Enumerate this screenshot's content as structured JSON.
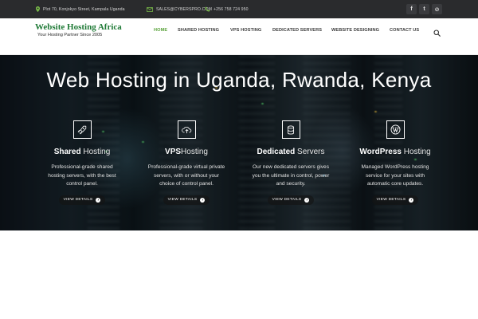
{
  "topbar": {
    "address": "Plot 70, Konjokyo Street, Kampala Uganda",
    "email": "SALES@CYBERSPRO.COM",
    "phone": "+256 758 724 950",
    "social": [
      {
        "icon": "facebook-icon",
        "glyph": "f"
      },
      {
        "icon": "twitter-icon",
        "glyph": "t"
      },
      {
        "icon": "rss-icon",
        "glyph": "⊘"
      }
    ]
  },
  "header": {
    "logo_title": "Website Hosting Africa",
    "logo_tagline": "Your Hosting Partner Since 2005",
    "nav": [
      {
        "label": "HOME",
        "active": true
      },
      {
        "label": "SHARED HOSTING",
        "active": false
      },
      {
        "label": "VPS HOSTING",
        "active": false
      },
      {
        "label": "DEDICATED SERVERS",
        "active": false
      },
      {
        "label": "WEBSITE DESIGNING",
        "active": false
      },
      {
        "label": "CONTACT US",
        "active": false
      }
    ],
    "search_icon": "search-icon"
  },
  "hero": {
    "title": "Web Hosting in Uganda, Rwanda, Kenya",
    "services": [
      {
        "icon": "rocket-icon",
        "title_bold": "Shared",
        "title_light": " Hosting",
        "description": "Professional-grade shared hosting servers, with the best control panel.",
        "button": "VIEW DETAILS"
      },
      {
        "icon": "cloud-upload-icon",
        "title_bold": "VPS",
        "title_light": "Hosting",
        "description": "Professional-grade virtual private servers, with or without your choice of control panel.",
        "button": "VIEW DETAILS"
      },
      {
        "icon": "database-icon",
        "title_bold": "Dedicated",
        "title_light": " Servers",
        "description": "Our new dedicated servers gives you the ultimate in control, power and security.",
        "button": "VIEW DETAILS"
      },
      {
        "icon": "wordpress-icon",
        "title_bold": "WordPress",
        "title_light": " Hosting",
        "description": "Managed WordPress hosting service for your sites with automatic core updates.",
        "button": "VIEW DETAILS"
      }
    ]
  },
  "colors": {
    "brand_green": "#1f7a36",
    "nav_active": "#5aa33b",
    "topbar_bg": "#2a2b2d"
  }
}
